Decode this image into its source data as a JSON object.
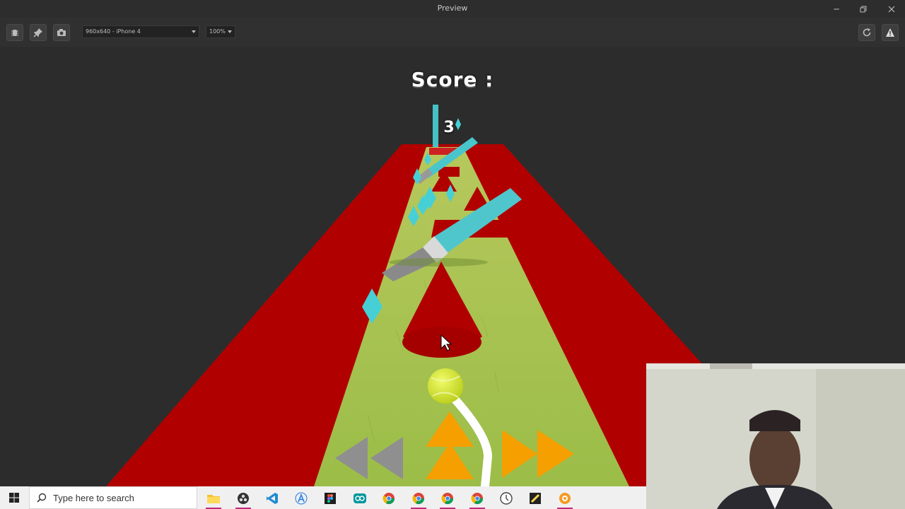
{
  "window": {
    "title": "Preview"
  },
  "toolbar": {
    "device_select": "960x640 - iPhone 4",
    "zoom_select": "100%"
  },
  "game": {
    "score_label": "Score :",
    "score_value": "3"
  },
  "taskbar": {
    "search_placeholder": "Type here to search",
    "apps": [
      "file-explorer",
      "obs-studio",
      "vs-code",
      "arduino-like",
      "figma",
      "arduino",
      "chrome",
      "chrome-profile-2",
      "chrome-profile-3",
      "chrome-profile-4",
      "clock-app",
      "sticky-notes",
      "app-orange"
    ]
  },
  "colors": {
    "track_green": "#a6c24d",
    "track_red": "#b10000",
    "crystal": "#46d0d6",
    "arrow_active": "#f5a000",
    "arrow_inactive": "#8f8f8f",
    "ball": "#d8ea2a"
  }
}
